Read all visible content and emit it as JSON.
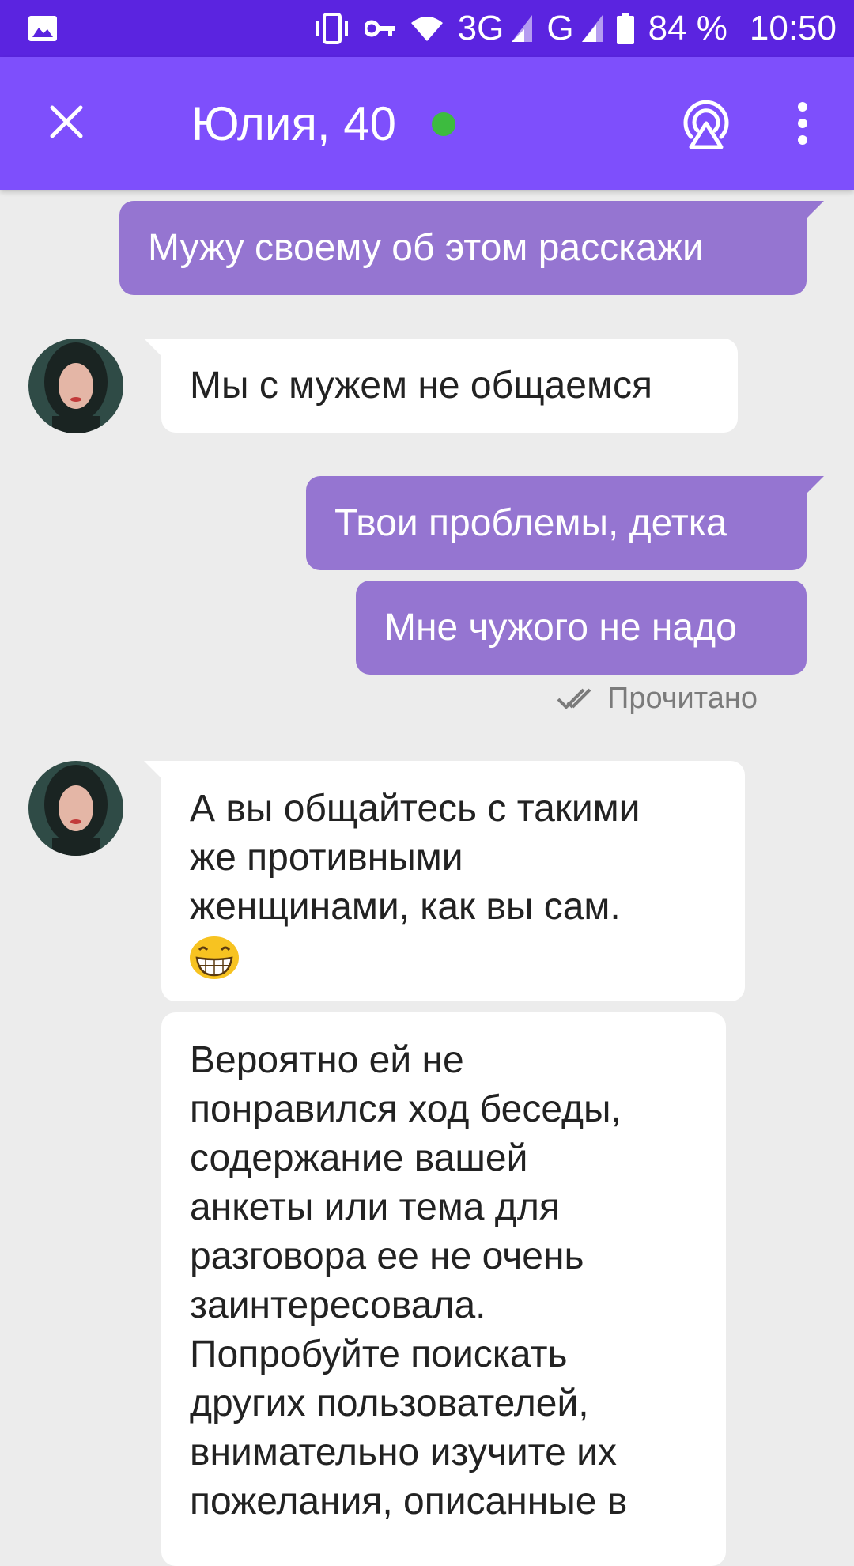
{
  "status_bar": {
    "network_1": "3G",
    "network_2": "G",
    "battery": "84 %",
    "time": "10:50",
    "icons": [
      "gallery-icon",
      "vibrate-icon",
      "vpn-key-icon",
      "wifi-icon",
      "signal-icon",
      "signal-icon",
      "battery-icon"
    ]
  },
  "header": {
    "title": "Юлия, 40",
    "online": true,
    "icons": [
      "close-icon",
      "stream-icon",
      "more-vert-icon"
    ]
  },
  "colors": {
    "status_bar": "#5b24e0",
    "app_bar": "#7e4ffc",
    "outgoing_bubble": "#9575d1",
    "incoming_bubble": "#ffffff",
    "background": "#ececec",
    "online_dot": "#3dbb3f"
  },
  "messages": [
    {
      "direction": "out",
      "text": "Мужу своему об этом расскажи"
    },
    {
      "direction": "in",
      "text": "Мы с мужем не общаемся"
    },
    {
      "direction": "out",
      "text": "Твои проблемы, детка"
    },
    {
      "direction": "out",
      "text": "Мне чужого не надо"
    },
    {
      "direction": "in",
      "lines": [
        "А вы общайтесь с такими",
        "же противными",
        "женщинами, как вы сам."
      ],
      "emoji": "grinning-face-emoji"
    },
    {
      "direction": "in",
      "lines": [
        "Вероятно ей не",
        "понравился ход беседы,",
        "содержание вашей",
        "анкеты или тема для",
        "разговора ее не очень",
        "заинтересовала.",
        "Попробуйте поискать",
        "других пользователей,",
        "внимательно изучите их",
        "пожелания, описанные в"
      ]
    }
  ],
  "read_status": "Прочитано"
}
